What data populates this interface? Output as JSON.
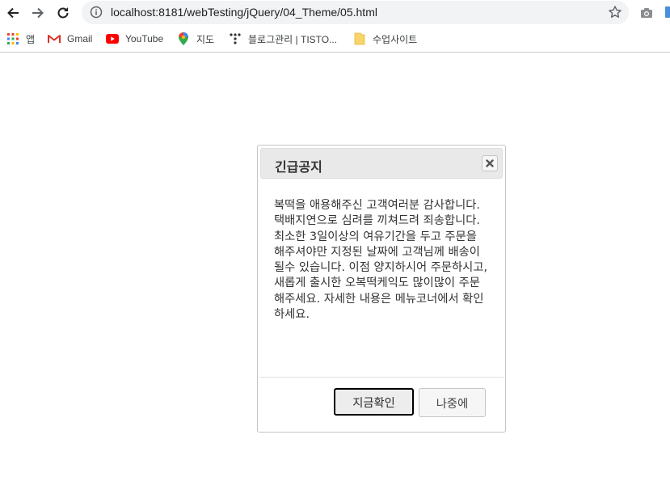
{
  "browser": {
    "url": "localhost:8181/webTesting/jQuery/04_Theme/05.html"
  },
  "bookmarks": [
    {
      "label": "앱",
      "icon": "apps-grid-icon"
    },
    {
      "label": "Gmail",
      "icon": "gmail-icon"
    },
    {
      "label": "YouTube",
      "icon": "youtube-icon"
    },
    {
      "label": "지도",
      "icon": "maps-pin-icon"
    },
    {
      "label": "블로그관리 | TISTO...",
      "icon": "tistory-icon"
    },
    {
      "label": "수업사이트",
      "icon": "folder-icon"
    }
  ],
  "dialog": {
    "title": "긴급공지",
    "message": "복떡을 애용해주신 고객여러분 감사합니다. 택배지연으로 심려를 끼쳐드려 죄송합니다. 최소한 3일이상의 여유기간을 두고 주문을 해주셔야만 지정된 날짜에 고객님께 배송이 될수 있습니다. 이점 양지하시어 주문하시고, 새롭게 출시한 오복떡케익도 많이많이 주문해주세요. 자세한 내용은 메뉴코너에서 확인하세요.",
    "confirm_label": "지금확인",
    "later_label": "나중에"
  },
  "colors": {
    "titlebar_bg": "#e9e9e9",
    "button_bg": "#f6f6f6",
    "border": "#c5c5c5"
  }
}
